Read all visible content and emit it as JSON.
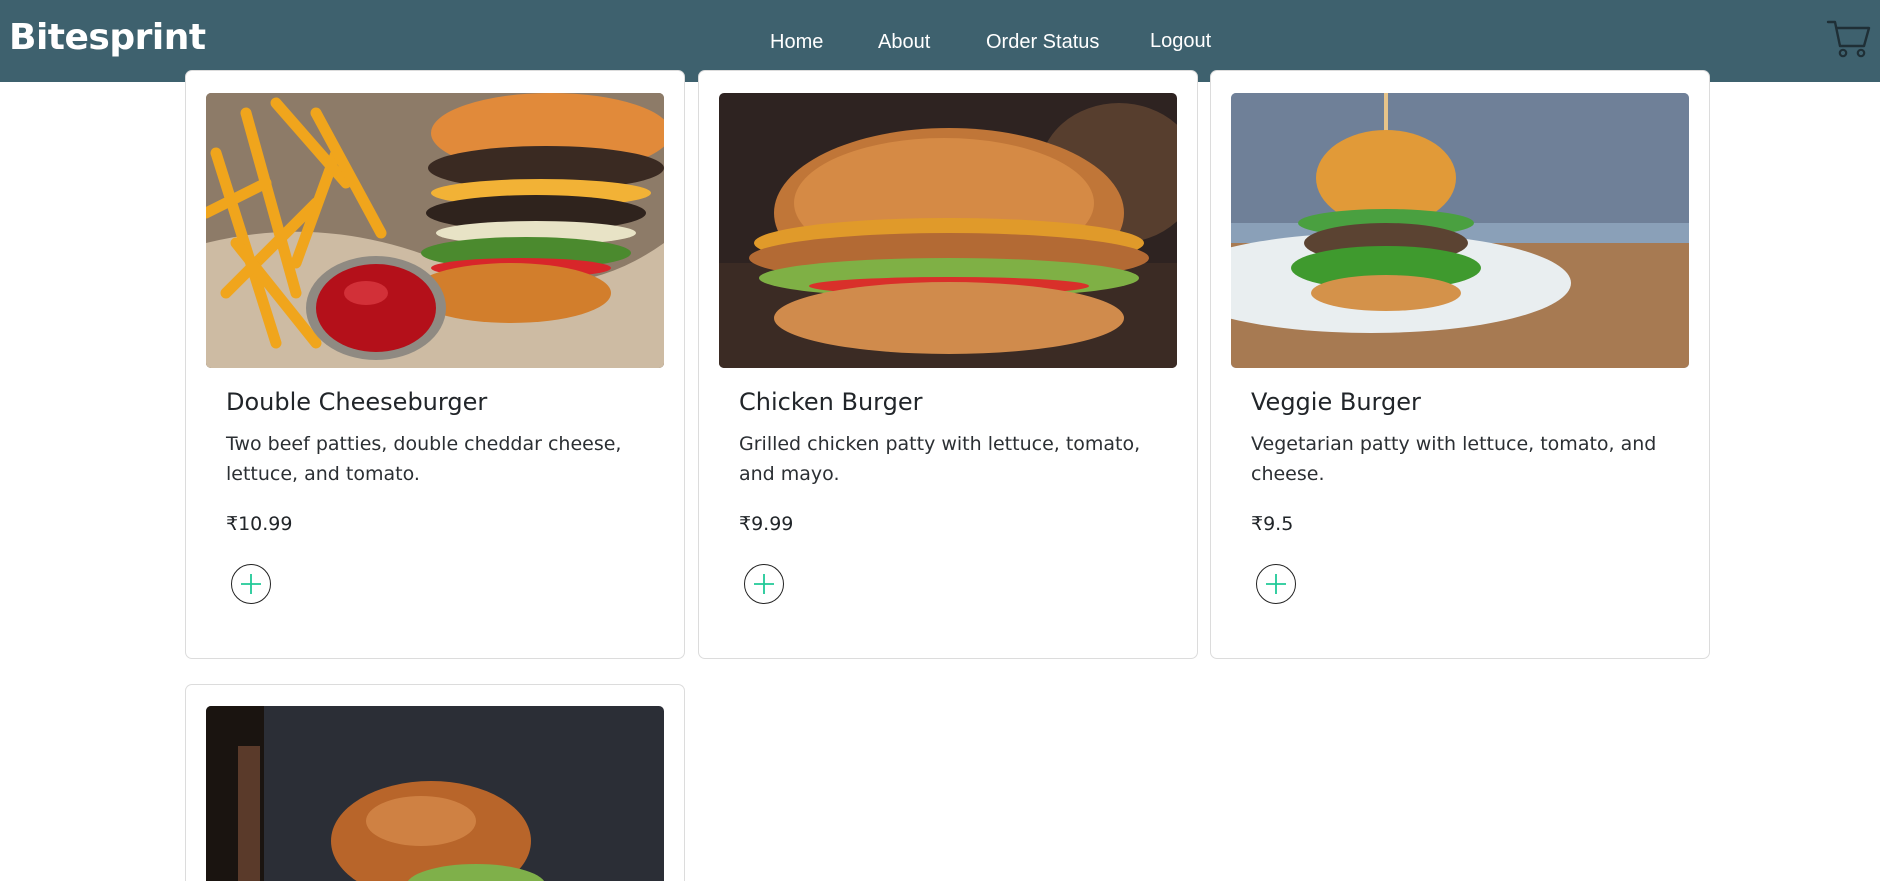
{
  "navbar": {
    "brand": "Bitesprint",
    "links": [
      "Home",
      "About",
      "Order Status",
      "Logout"
    ],
    "cart_icon": "cart-icon",
    "bg_color": "#3e616e"
  },
  "menu": {
    "currency": "₹",
    "items": [
      {
        "name": "Double Cheeseburger",
        "description": "Two beef patties, double cheddar cheese, lettuce, and tomato.",
        "price": "₹10.99",
        "image": "double-cheeseburger-with-fries-image"
      },
      {
        "name": "Chicken Burger",
        "description": "Grilled chicken patty with lettuce, tomato, and mayo.",
        "price": "₹9.99",
        "image": "chicken-burger-image"
      },
      {
        "name": "Veggie Burger",
        "description": "Vegetarian patty with lettuce, tomato, and cheese.",
        "price": "₹9.5",
        "image": "veggie-burger-image"
      },
      {
        "name": "",
        "description": "",
        "price": "",
        "image": "burger-on-dark-background-image"
      }
    ],
    "add_icon": "plus-icon",
    "add_accent_color": "#20c997"
  }
}
